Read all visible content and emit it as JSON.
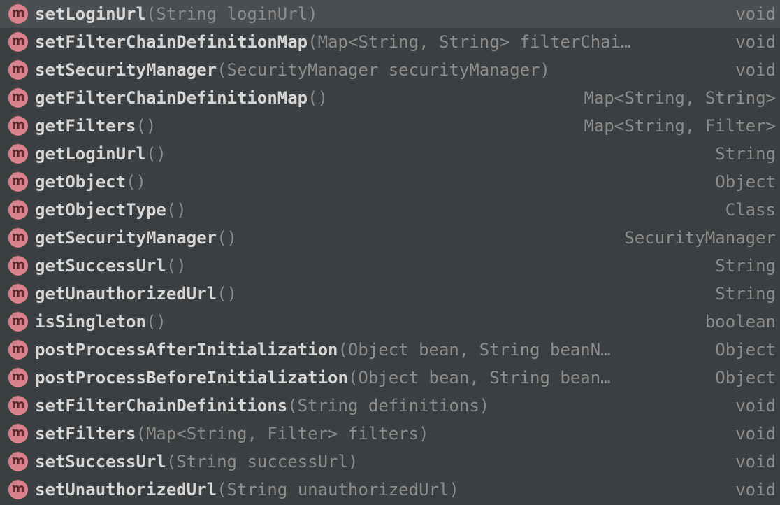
{
  "completion": {
    "icon_letter": "m",
    "icon_color": "#d9818b",
    "selected_index": 0,
    "items": [
      {
        "name": "setLoginUrl",
        "params": "(String loginUrl)",
        "return_type": "void"
      },
      {
        "name": "setFilterChainDefinitionMap",
        "params": "(Map<String, String> filterChai…",
        "return_type": "void"
      },
      {
        "name": "setSecurityManager",
        "params": "(SecurityManager securityManager)",
        "return_type": "void"
      },
      {
        "name": "getFilterChainDefinitionMap",
        "params": "()",
        "return_type": "Map<String, String>"
      },
      {
        "name": "getFilters",
        "params": "()",
        "return_type": "Map<String, Filter>"
      },
      {
        "name": "getLoginUrl",
        "params": "()",
        "return_type": "String"
      },
      {
        "name": "getObject",
        "params": "()",
        "return_type": "Object"
      },
      {
        "name": "getObjectType",
        "params": "()",
        "return_type": "Class"
      },
      {
        "name": "getSecurityManager",
        "params": "()",
        "return_type": "SecurityManager"
      },
      {
        "name": "getSuccessUrl",
        "params": "()",
        "return_type": "String"
      },
      {
        "name": "getUnauthorizedUrl",
        "params": "()",
        "return_type": "String"
      },
      {
        "name": "isSingleton",
        "params": "()",
        "return_type": "boolean"
      },
      {
        "name": "postProcessAfterInitialization",
        "params": "(Object bean, String beanN…",
        "return_type": "Object"
      },
      {
        "name": "postProcessBeforeInitialization",
        "params": "(Object bean, String bean…",
        "return_type": "Object"
      },
      {
        "name": "setFilterChainDefinitions",
        "params": "(String definitions)",
        "return_type": "void"
      },
      {
        "name": "setFilters",
        "params": "(Map<String, Filter> filters)",
        "return_type": "void"
      },
      {
        "name": "setSuccessUrl",
        "params": "(String successUrl)",
        "return_type": "void"
      },
      {
        "name": "setUnauthorizedUrl",
        "params": "(String unauthorizedUrl)",
        "return_type": "void"
      }
    ]
  }
}
